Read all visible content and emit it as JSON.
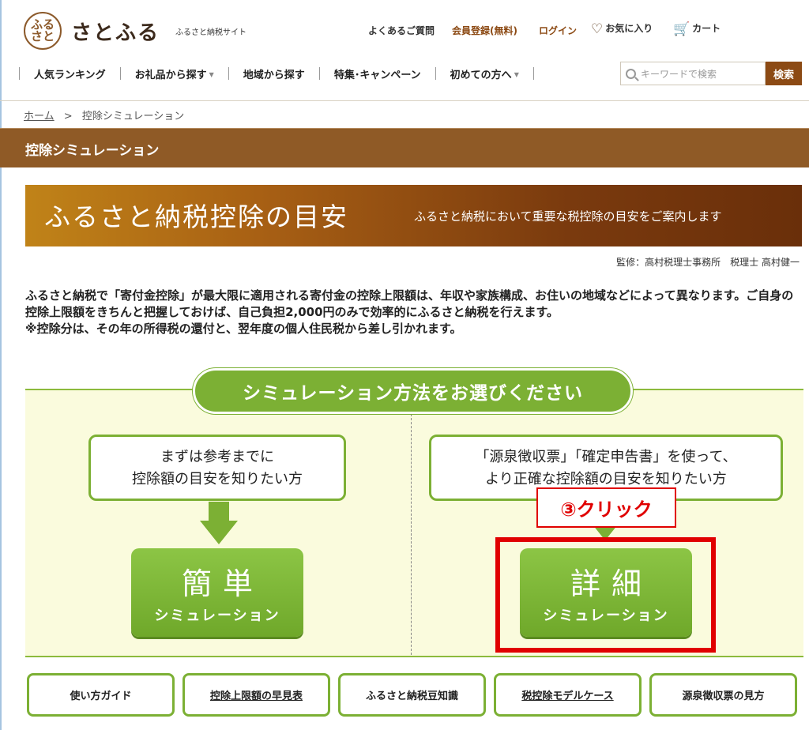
{
  "header": {
    "logo_seal": "ふる\nさと",
    "logo_name": "さとふる",
    "logo_sub": "ふるさと納税サイト",
    "utility": {
      "faq": "よくあるご質問",
      "register": "会員登録(無料)",
      "login": "ログイン",
      "favorites": "お気に入り",
      "cart": "カート"
    },
    "nav": [
      {
        "label": "人気ランキング",
        "dropdown": false
      },
      {
        "label": "お礼品から探す",
        "dropdown": true
      },
      {
        "label": "地域から探す",
        "dropdown": false
      },
      {
        "label": "特集･キャンペーン",
        "dropdown": false
      },
      {
        "label": "初めての方へ",
        "dropdown": true
      }
    ],
    "search": {
      "placeholder": "キーワードで検索",
      "button": "検索"
    }
  },
  "breadcrumb": {
    "home": "ホーム",
    "separator": ">",
    "current": "控除シミュレーション"
  },
  "page_title": "控除シミュレーション",
  "banner": {
    "title": "ふるさと納税控除の目安",
    "subtitle": "ふるさと納税において重要な税控除の目安をご案内します"
  },
  "supervision": "監修：高村税理士事務所　税理士 高村健一",
  "intro": {
    "line1": "ふるさと納税で「寄付金控除」が最大限に適用される寄付金の控除上限額は、年収や家族構成、お住いの地域などによって異なります。ご自身の控除上限額をきちんと把握しておけば、自己負担2,000円のみで効率的にふるさと納税を行えます。",
    "line2": "※控除分は、その年の所得税の還付と、翌年度の個人住民税から差し引かれます。"
  },
  "simulation": {
    "heading": "シミュレーション方法をお選びください",
    "easy": {
      "bubble_l1": "まずは参考までに",
      "bubble_l2": "控除額の目安を知りたい方",
      "button_big": "簡単",
      "button_small": "シミュレーション"
    },
    "detail": {
      "bubble_l1": "「源泉徴収票」「確定申告書」を使って、",
      "bubble_l2": "より正確な控除額の目安を知りたい方",
      "button_big": "詳細",
      "button_small": "シミュレーション"
    },
    "annotation": "③クリック",
    "annotation_color": "#e00000"
  },
  "tabs": [
    {
      "label": "使い方ガイド",
      "underline": false
    },
    {
      "label": "控除上限額の早見表",
      "underline": true
    },
    {
      "label": "ふるさと納税豆知識",
      "underline": false
    },
    {
      "label": "税控除モデルケース",
      "underline": true
    },
    {
      "label": "源泉徴収票の見方",
      "underline": false
    }
  ],
  "colors": {
    "brand_brown": "#8c4a14",
    "accent_green": "#7cb034",
    "panel_bg": "#fafbdd"
  }
}
